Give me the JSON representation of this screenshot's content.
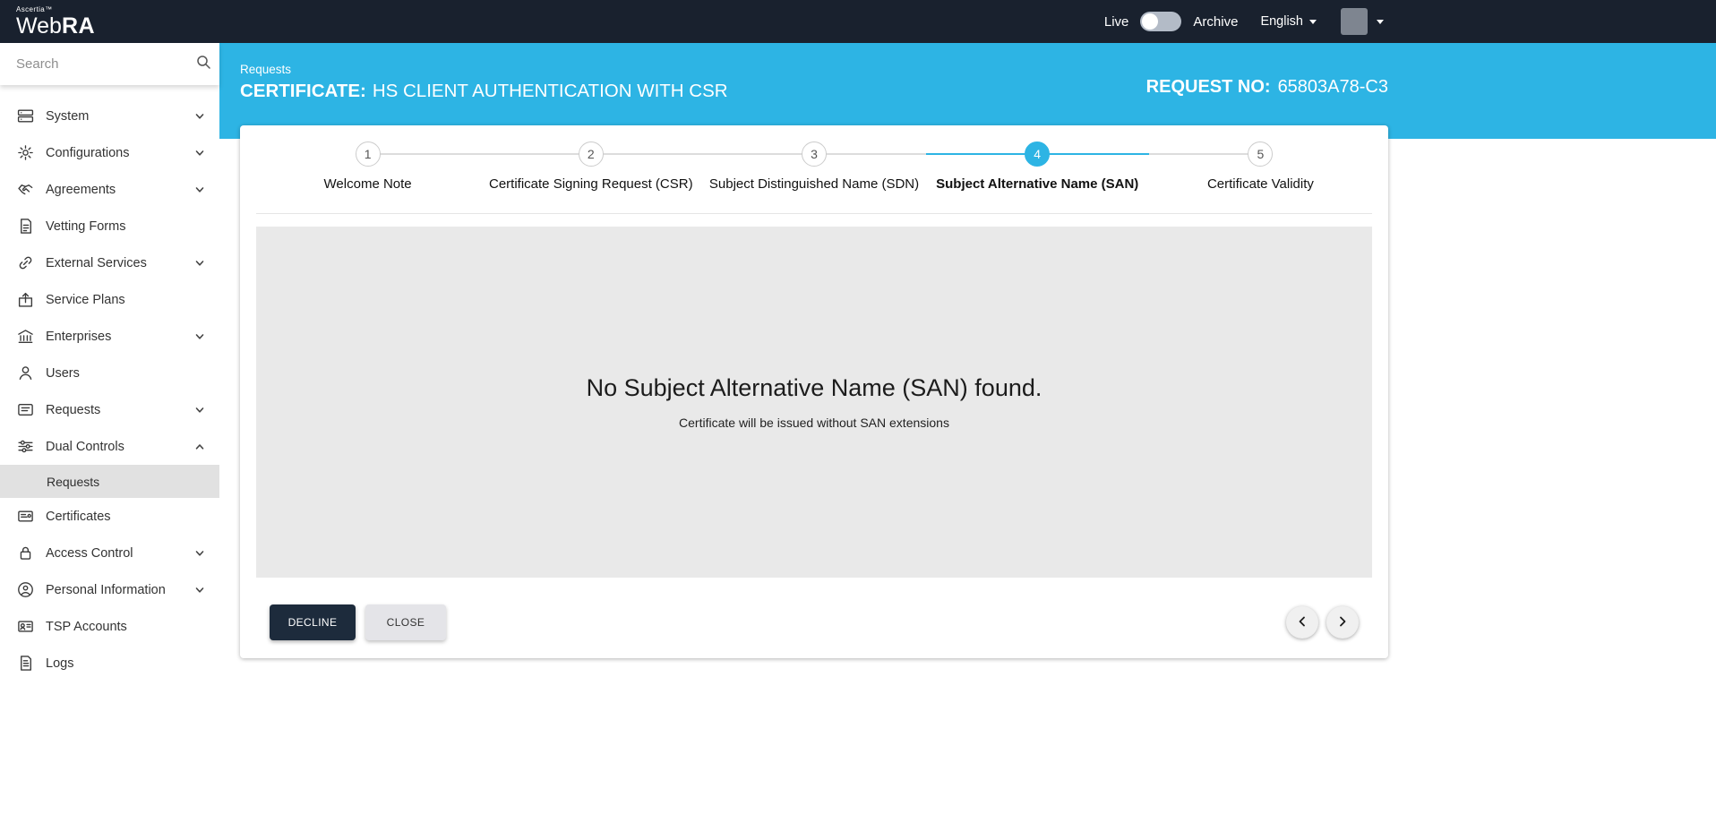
{
  "topbar": {
    "brand_small": "Ascertia™",
    "brand_web": "Web",
    "brand_ra": "RA",
    "live_label": "Live",
    "archive_label": "Archive",
    "language_label": "English"
  },
  "sidebar": {
    "search_placeholder": "Search",
    "items": [
      {
        "label": "System",
        "icon": "system-icon",
        "has_submenu": true
      },
      {
        "label": "Configurations",
        "icon": "configurations-icon",
        "has_submenu": true
      },
      {
        "label": "Agreements",
        "icon": "agreements-icon",
        "has_submenu": true
      },
      {
        "label": "Vetting Forms",
        "icon": "vetting-forms-icon",
        "has_submenu": false
      },
      {
        "label": "External Services",
        "icon": "external-services-icon",
        "has_submenu": true
      },
      {
        "label": "Service Plans",
        "icon": "service-plans-icon",
        "has_submenu": false
      },
      {
        "label": "Enterprises",
        "icon": "enterprises-icon",
        "has_submenu": true
      },
      {
        "label": "Users",
        "icon": "users-icon",
        "has_submenu": false
      },
      {
        "label": "Requests",
        "icon": "requests-icon",
        "has_submenu": true
      },
      {
        "label": "Dual Controls",
        "icon": "dual-controls-icon",
        "has_submenu": true,
        "expanded": true
      },
      {
        "label": "Requests",
        "parent": "Dual Controls",
        "active": true
      },
      {
        "label": "Certificates",
        "icon": "certificates-icon",
        "has_submenu": false
      },
      {
        "label": "Access Control",
        "icon": "access-control-icon",
        "has_submenu": true
      },
      {
        "label": "Personal Information",
        "icon": "personal-information-icon",
        "has_submenu": true
      },
      {
        "label": "TSP Accounts",
        "icon": "tsp-accounts-icon",
        "has_submenu": false
      },
      {
        "label": "Logs",
        "icon": "logs-icon",
        "has_submenu": false
      }
    ]
  },
  "header": {
    "breadcrumb": "Requests",
    "title_prefix": "CERTIFICATE:",
    "title": "HS CLIENT AUTHENTICATION WITH CSR",
    "request_no_label": "REQUEST NO:",
    "request_no_value": "65803A78-C3"
  },
  "stepper": {
    "active_step": 4,
    "steps": [
      {
        "number": "1",
        "label": "Welcome Note",
        "active": false
      },
      {
        "number": "2",
        "label": "Certificate Signing Request (CSR)",
        "active": false
      },
      {
        "number": "3",
        "label": "Subject Distinguished Name (SDN)",
        "active": false
      },
      {
        "number": "4",
        "label": "Subject Alternative Name (SAN)",
        "active": true
      },
      {
        "number": "5",
        "label": "Certificate Validity",
        "active": false
      }
    ]
  },
  "content": {
    "message": "No Subject Alternative Name (SAN) found.",
    "submessage": "Certificate will be issued without SAN extensions"
  },
  "actions": {
    "decline_label": "DECLINE",
    "close_label": "CLOSE"
  },
  "colors": {
    "accent": "#2db4e4",
    "topbar_bg": "#19212e",
    "decline_bg": "#1d2b3c",
    "panel_bg": "#e9e9e9",
    "active_item_bg": "#e1e1e1"
  }
}
